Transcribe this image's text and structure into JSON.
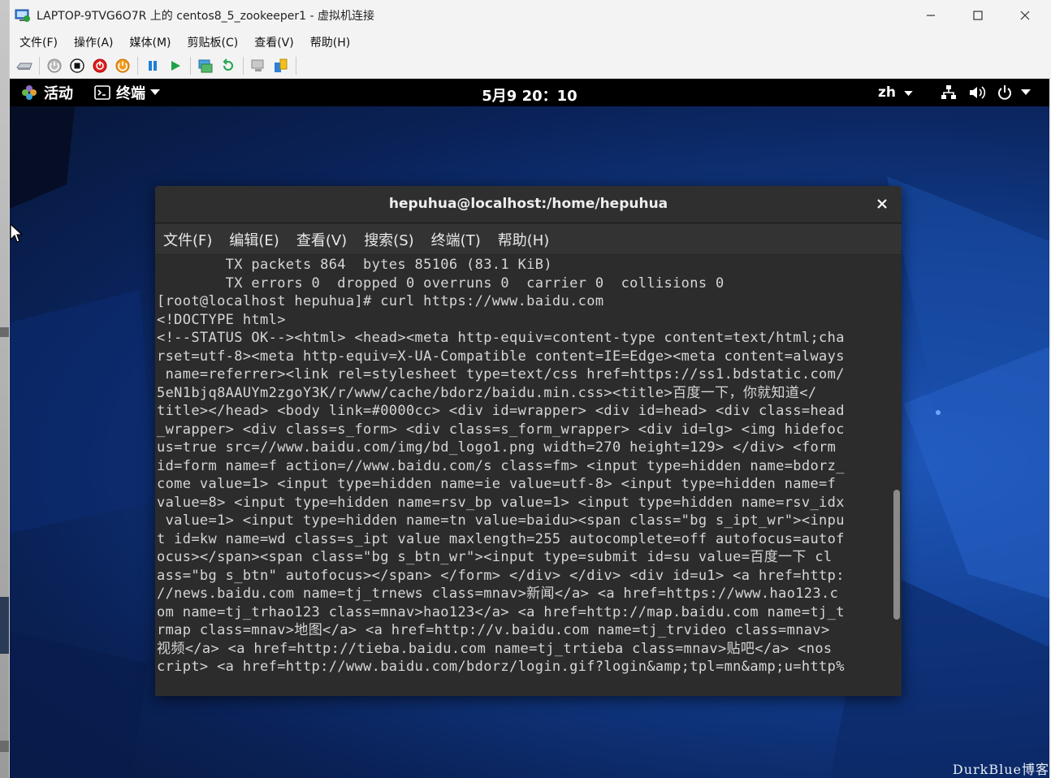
{
  "host": {
    "title": "LAPTOP-9TVG6O7R 上的 centos8_5_zookeeper1 - 虚拟机连接",
    "window_buttons": [
      "minimize-icon",
      "maximize-icon",
      "close-icon"
    ],
    "menu": [
      "文件(F)",
      "操作(A)",
      "媒体(M)",
      "剪贴板(C)",
      "查看(V)",
      "帮助(H)"
    ],
    "toolbar_icons": [
      "ctrl-alt-del-icon",
      "start-icon",
      "turn-off-icon",
      "shutdown-icon",
      "power-icon",
      "pause-icon",
      "resume-icon",
      "checkpoint-icon",
      "revert-icon",
      "enhanced-session-icon",
      "share-icon"
    ]
  },
  "guest": {
    "topbar": {
      "activities": "活动",
      "app_menu": "终端",
      "clock": "5月9 20：10",
      "lang": "zh"
    },
    "watermark": "DurkBlue博客"
  },
  "terminal": {
    "title": "hepuhua@localhost:/home/hepuhua",
    "menu": [
      "文件(F)",
      "编辑(E)",
      "查看(V)",
      "搜索(S)",
      "终端(T)",
      "帮助(H)"
    ],
    "lines": [
      "        TX packets 864  bytes 85106 (83.1 KiB)",
      "        TX errors 0  dropped 0 overruns 0  carrier 0  collisions 0",
      "",
      "[root@localhost hepuhua]# curl https://www.baidu.com",
      "<!DOCTYPE html>",
      "<!--STATUS OK--><html> <head><meta http-equiv=content-type content=text/html;cha",
      "rset=utf-8><meta http-equiv=X-UA-Compatible content=IE=Edge><meta content=always",
      " name=referrer><link rel=stylesheet type=text/css href=https://ss1.bdstatic.com/",
      "5eN1bjq8AAUYm2zgoY3K/r/www/cache/bdorz/baidu.min.css><title>百度一下，你就知道</",
      "title></head> <body link=#0000cc> <div id=wrapper> <div id=head> <div class=head",
      "_wrapper> <div class=s_form> <div class=s_form_wrapper> <div id=lg> <img hidefoc",
      "us=true src=//www.baidu.com/img/bd_logo1.png width=270 height=129> </div> <form",
      "id=form name=f action=//www.baidu.com/s class=fm> <input type=hidden name=bdorz_",
      "come value=1> <input type=hidden name=ie value=utf-8> <input type=hidden name=f",
      "value=8> <input type=hidden name=rsv_bp value=1> <input type=hidden name=rsv_idx",
      " value=1> <input type=hidden name=tn value=baidu><span class=\"bg s_ipt_wr\"><inpu",
      "t id=kw name=wd class=s_ipt value maxlength=255 autocomplete=off autofocus=autof",
      "ocus></span><span class=\"bg s_btn_wr\"><input type=submit id=su value=百度一下 cl",
      "ass=\"bg s_btn\" autofocus></span> </form> </div> </div> <div id=u1> <a href=http:",
      "//news.baidu.com name=tj_trnews class=mnav>新闻</a> <a href=https://www.hao123.c",
      "om name=tj_trhao123 class=mnav>hao123</a> <a href=http://map.baidu.com name=tj_t",
      "rmap class=mnav>地图</a> <a href=http://v.baidu.com name=tj_trvideo class=mnav>",
      "视频</a> <a href=http://tieba.baidu.com name=tj_trtieba class=mnav>贴吧</a> <nos",
      "cript> <a href=http://www.baidu.com/bdorz/login.gif?login&amp;tpl=mn&amp;u=http%"
    ]
  }
}
